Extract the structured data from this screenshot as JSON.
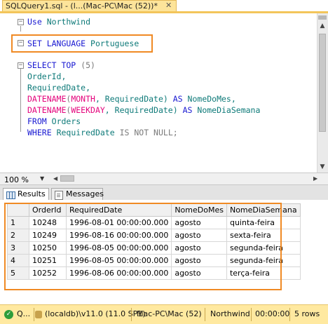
{
  "document_tab": {
    "title": "SQLQuery1.sql - (l...(Mac-PC\\Mac (52))*",
    "close_glyph": "✕"
  },
  "editor": {
    "line1": [
      "Use",
      "Northwind"
    ],
    "line2": [
      "SET LANGUAGE",
      "Portuguese"
    ],
    "line3": [
      "SELECT TOP",
      "(5)"
    ],
    "line4": "OrderId,",
    "line5": "RequiredDate,",
    "line6": [
      "DATENAME",
      "(",
      "MONTH",
      ", RequiredDate)",
      "AS",
      "NomeDoMes,"
    ],
    "line7": [
      "DATENAME",
      "(",
      "WEEKDAY",
      ", RequiredDate)",
      "AS",
      "NomeDiaSemana"
    ],
    "line8": [
      "FROM",
      "Orders"
    ],
    "line9": [
      "WHERE",
      "RequiredDate",
      "IS NOT NULL",
      ";"
    ],
    "collapse_glyph": "−"
  },
  "zoom": {
    "value": "100 %",
    "arrow": "▼"
  },
  "result_tabs": {
    "results": "Results",
    "messages": "Messages"
  },
  "grid": {
    "columns": [
      "OrderId",
      "RequiredDate",
      "NomeDoMes",
      "NomeDiaSemana"
    ],
    "rows": [
      {
        "n": "1",
        "order": "10248",
        "date": "1996-08-01 00:00:00.000",
        "mes": "agosto",
        "dia": "quinta-feira"
      },
      {
        "n": "2",
        "order": "10249",
        "date": "1996-08-16 00:00:00.000",
        "mes": "agosto",
        "dia": "sexta-feira"
      },
      {
        "n": "3",
        "order": "10250",
        "date": "1996-08-05 00:00:00.000",
        "mes": "agosto",
        "dia": "segunda-feira"
      },
      {
        "n": "4",
        "order": "10251",
        "date": "1996-08-05 00:00:00.000",
        "mes": "agosto",
        "dia": "segunda-feira"
      },
      {
        "n": "5",
        "order": "10252",
        "date": "1996-08-06 00:00:00.000",
        "mes": "agosto",
        "dia": "terça-feira"
      }
    ]
  },
  "status": {
    "ok_glyph": "✓",
    "query_state": "Q...",
    "server": "(localdb)\\v11.0 (11.0 SP1)",
    "user": "Mac-PC\\Mac (52)",
    "database": "Northwind",
    "elapsed": "00:00:00",
    "rows": "5 rows"
  },
  "colors": {
    "highlight_box": "#f08a24",
    "keyword": "#1919d2",
    "function": "#e4047c",
    "tab_active": "#fde49a",
    "status_bar": "#ffe9a0"
  }
}
